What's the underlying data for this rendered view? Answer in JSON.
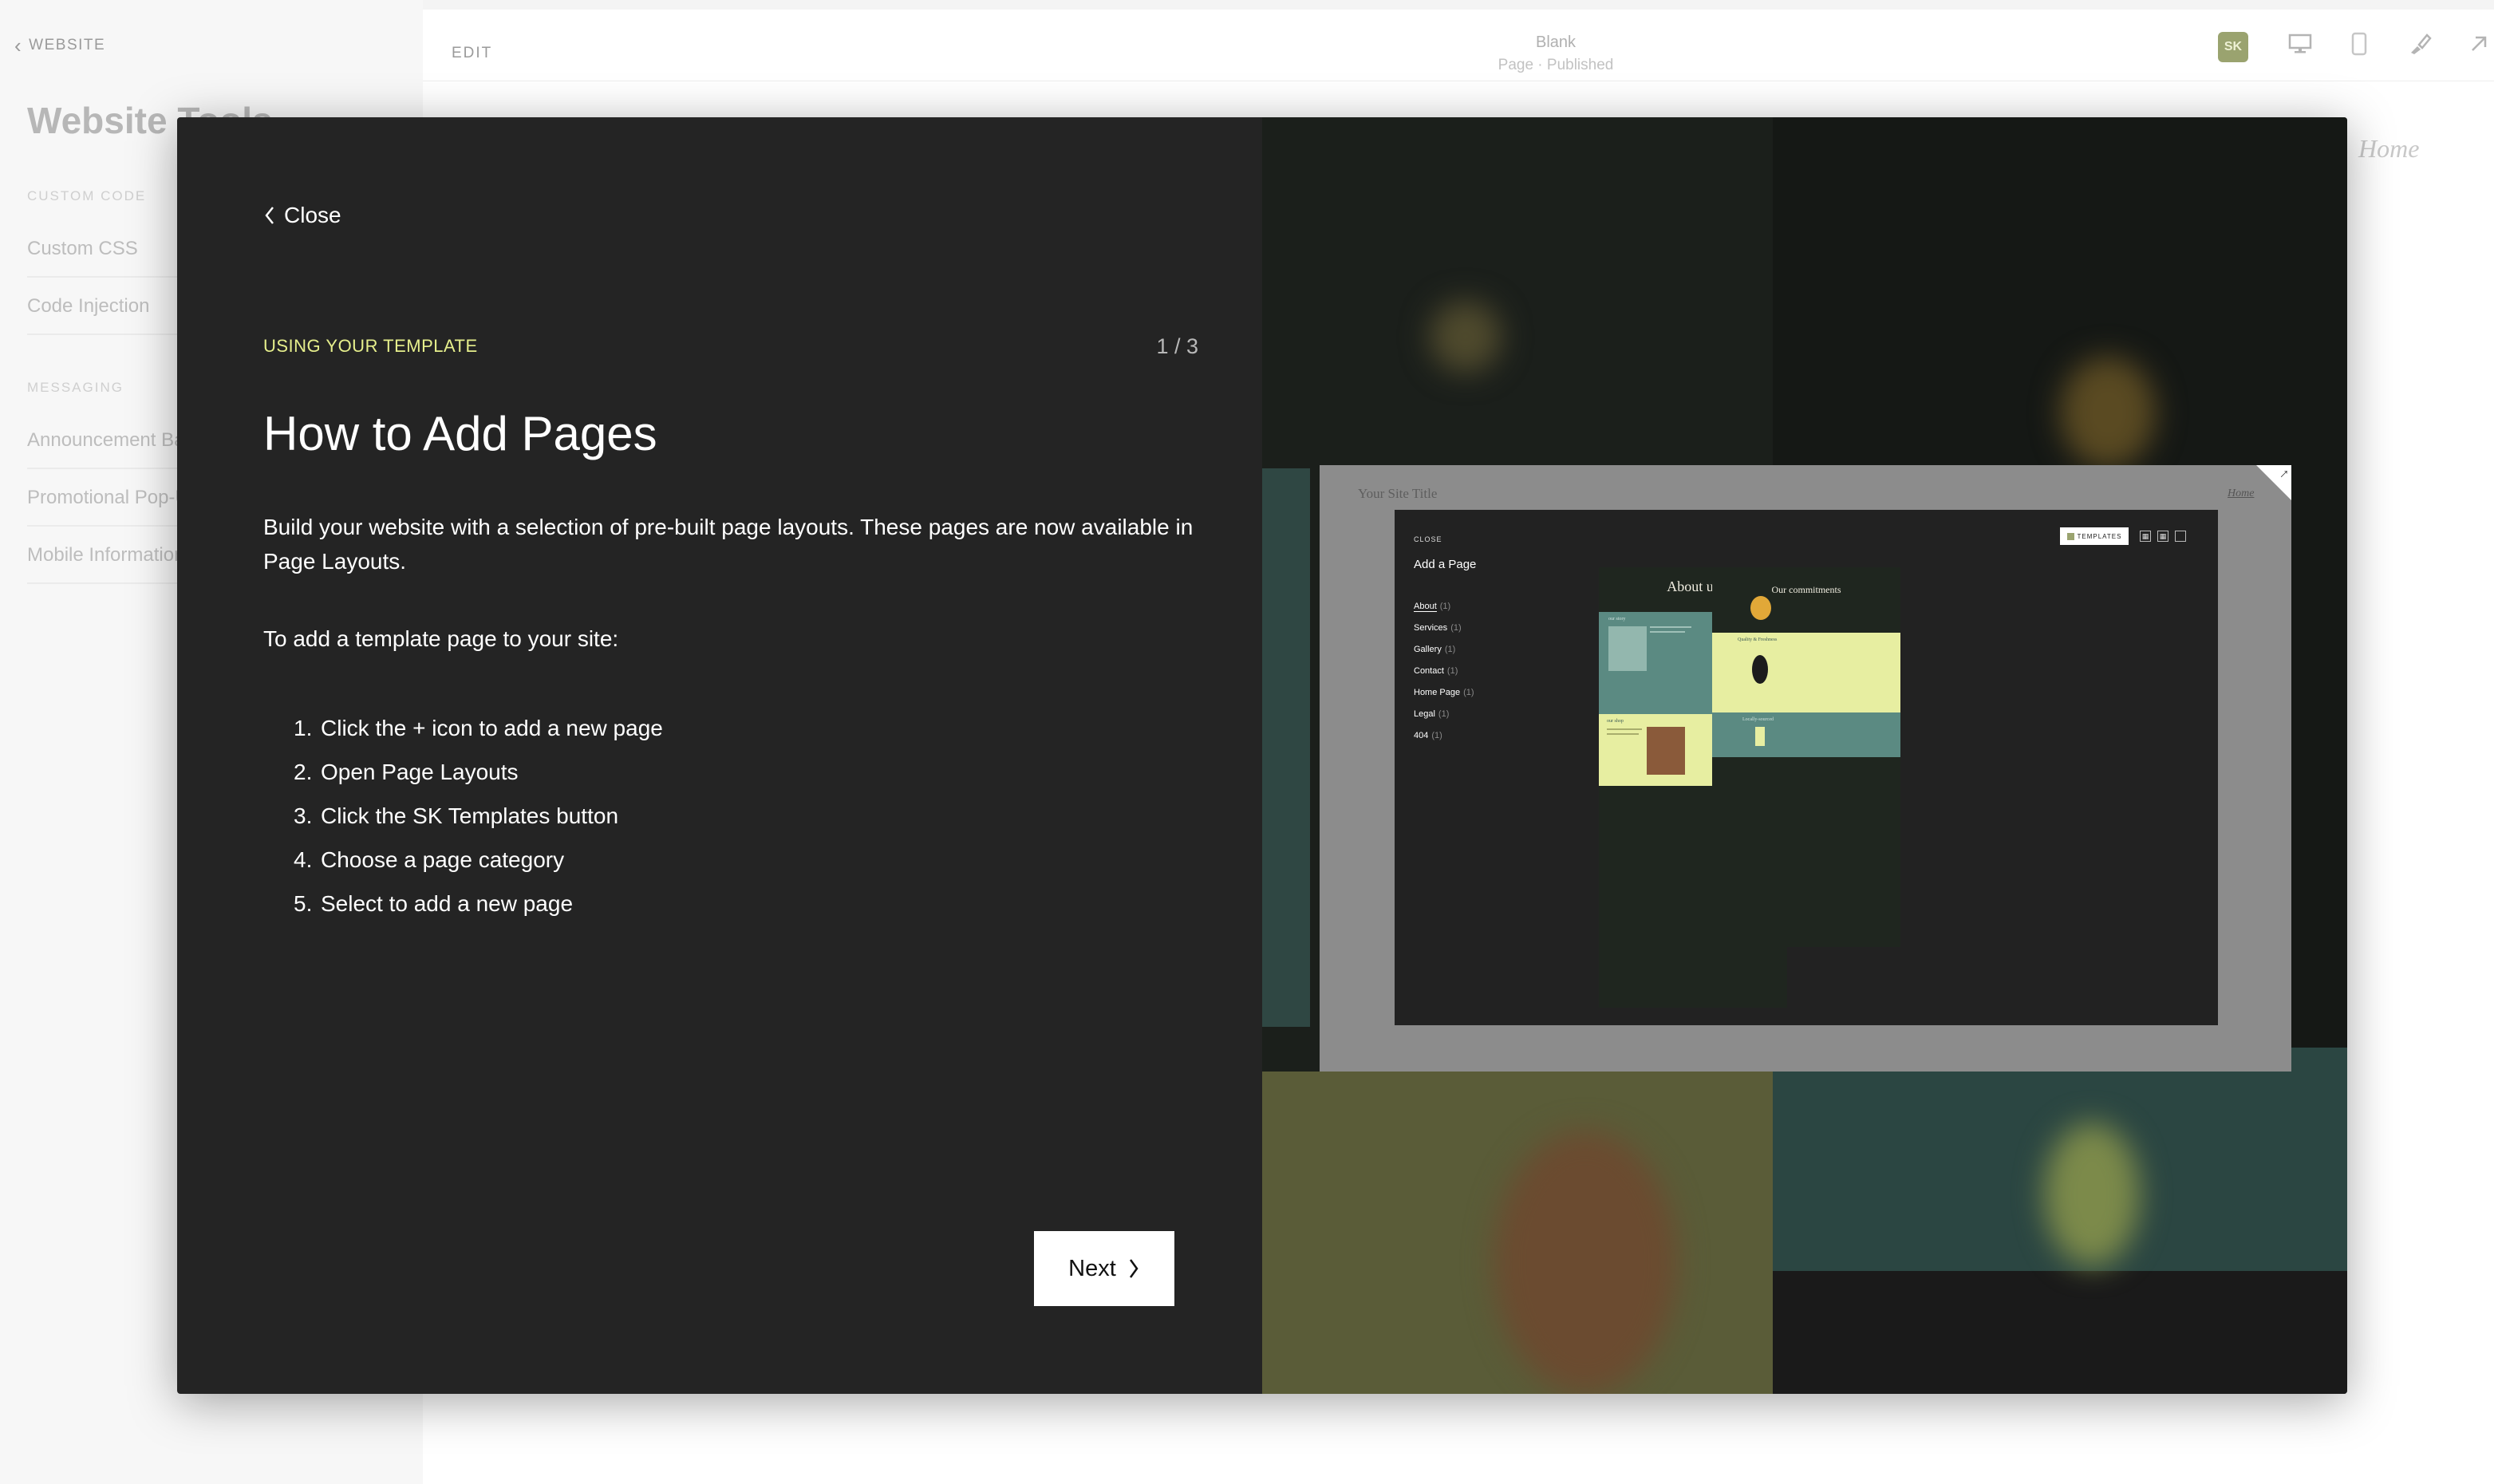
{
  "editor": {
    "back_label": "WEBSITE",
    "panel_title": "Website Tools",
    "sections": [
      {
        "heading": "CUSTOM CODE",
        "items": [
          "Custom CSS",
          "Code Injection"
        ]
      },
      {
        "heading": "MESSAGING",
        "items": [
          "Announcement Bar",
          "Promotional Pop-Up",
          "Mobile Information Bar"
        ]
      }
    ],
    "edit_label": "EDIT",
    "page_title": "Blank",
    "page_status": "Page · Published",
    "badge_label": "SK",
    "canvas_nav_link": "Home",
    "accent_badge_color": "#9aa36f"
  },
  "modal": {
    "close_label": "Close",
    "eyebrow": "USING YOUR TEMPLATE",
    "counter": "1 / 3",
    "heading": "How to Add Pages",
    "description": "Build your website with a selection of pre-built page layouts. These pages are now available in Page Layouts.",
    "intro": "To add a template page to your site:",
    "steps": [
      {
        "num": "1.",
        "text": "Click the + icon to add a new page"
      },
      {
        "num": "2.",
        "text": "Open Page Layouts"
      },
      {
        "num": "3.",
        "text": "Click the SK Templates button"
      },
      {
        "num": "4.",
        "text": "Choose a page category"
      },
      {
        "num": "5.",
        "text": "Select to add a new page"
      }
    ],
    "next_label": "Next",
    "eyebrow_color": "#e6ef8c"
  },
  "preview": {
    "site_title": "Your Site Title",
    "home_link": "Home",
    "mini_close": "CLOSE",
    "mini_title": "Add a Page",
    "mini_pages": [
      {
        "name": "About",
        "count": "(1)"
      },
      {
        "name": "Services",
        "count": "(1)"
      },
      {
        "name": "Gallery",
        "count": "(1)"
      },
      {
        "name": "Contact",
        "count": "(1)"
      },
      {
        "name": "Home Page",
        "count": "(1)"
      },
      {
        "name": "Legal",
        "count": "(1)"
      },
      {
        "name": "404",
        "count": "(1)"
      }
    ],
    "templates_button": "TEMPLATES",
    "card1_title": "About us",
    "card1_label_a": "our story",
    "card1_label_b": "our shop",
    "card2_title": "Our commitments",
    "card2_label_a": "Quality & Freshness",
    "card2_label_b": "Locally-sourced",
    "teal": "#5b8a82",
    "yellow": "#e7eea1"
  }
}
